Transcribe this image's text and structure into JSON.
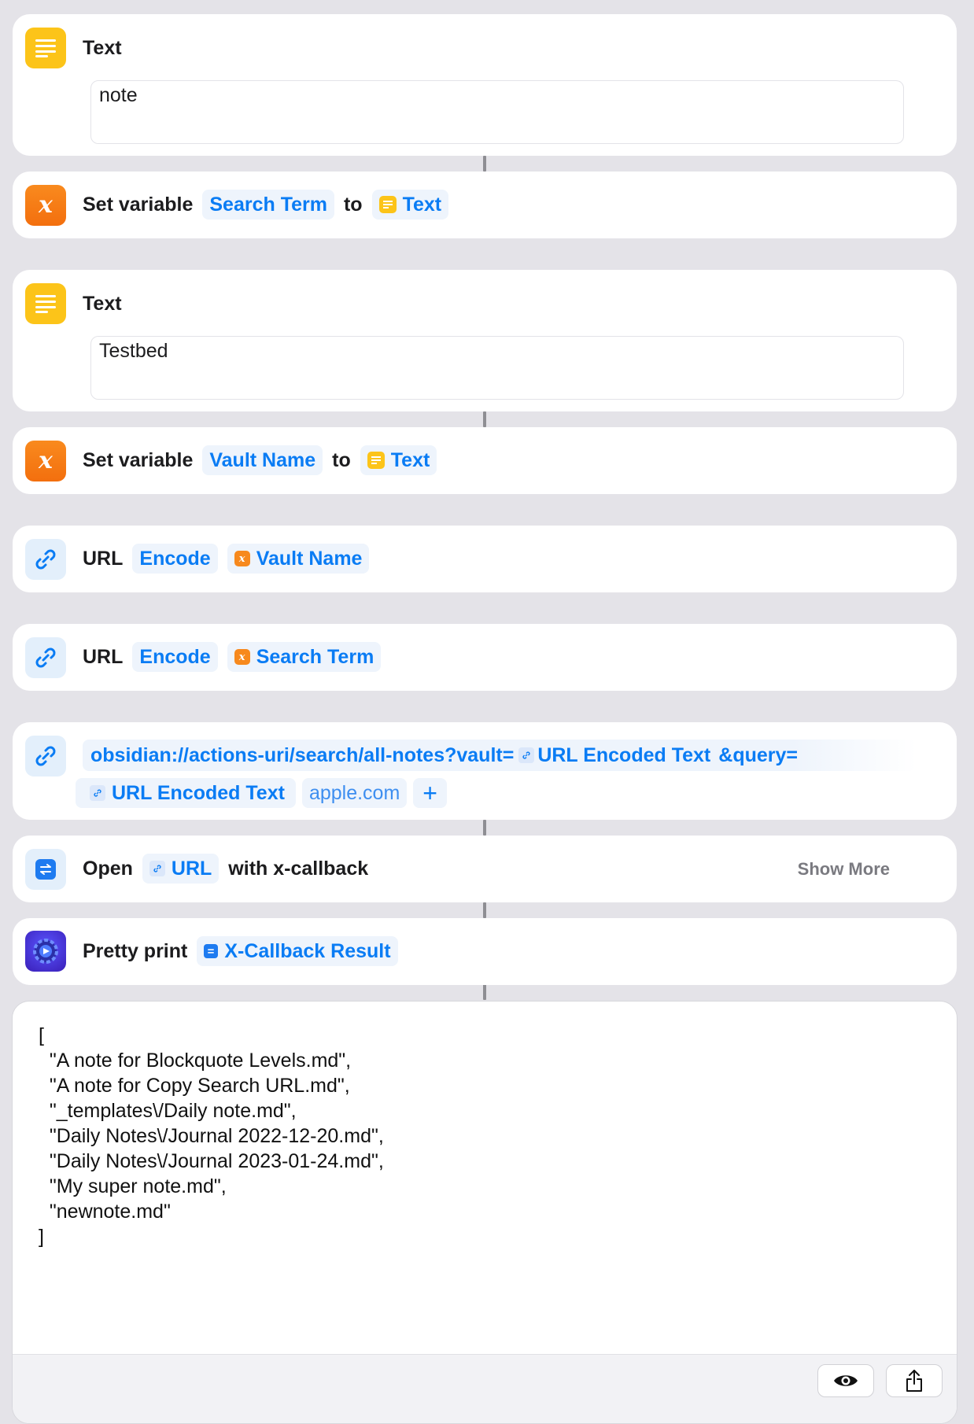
{
  "actions": {
    "text1": {
      "title": "Text",
      "value": "note"
    },
    "setvar1": {
      "label": "Set variable",
      "variable": "Search Term",
      "connector": "to",
      "source": "Text"
    },
    "text2": {
      "title": "Text",
      "value": "Testbed"
    },
    "setvar2": {
      "label": "Set variable",
      "variable": "Vault Name",
      "connector": "to",
      "source": "Text"
    },
    "urlencode1": {
      "label": "URL",
      "mode": "Encode",
      "input": "Vault Name"
    },
    "urlencode2": {
      "label": "URL",
      "mode": "Encode",
      "input": "Search Term"
    },
    "urlbuild": {
      "prefix": "obsidian://actions-uri/search/all-notes?vault=",
      "token1": "URL Encoded Text",
      "middle": "&query=",
      "token2": "URL Encoded Text",
      "placeholder": "apple.com",
      "add": "+"
    },
    "open": {
      "label": "Open",
      "input": "URL",
      "suffix": "with x-callback",
      "show_more": "Show More"
    },
    "prettyprint": {
      "label": "Pretty print",
      "input": "X-Callback Result"
    }
  },
  "output": {
    "text": "[\n  \"A note for Blockquote Levels.md\",\n  \"A note for Copy Search URL.md\",\n  \"_templates\\/Daily note.md\",\n  \"Daily Notes\\/Journal 2022-12-20.md\",\n  \"Daily Notes\\/Journal 2023-01-24.md\",\n  \"My super note.md\",\n  \"newnote.md\"\n]"
  },
  "colors": {
    "accent": "#0a7cf4",
    "text_icon": "#fcc419",
    "variable_icon": "#f7891d",
    "background": "#e4e3e8"
  },
  "icons": {
    "text": "text-lines-icon",
    "variable": "variable-x-icon",
    "url": "link-icon",
    "xcallback": "x-callback-icon",
    "prettyprint": "gear-icon",
    "preview": "eye-icon",
    "share": "share-icon"
  }
}
